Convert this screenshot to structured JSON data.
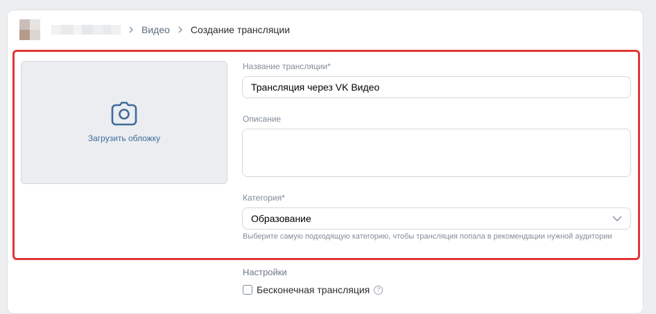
{
  "breadcrumb": {
    "items": [
      {
        "label": "Видео"
      },
      {
        "label": "Создание трансляции"
      }
    ]
  },
  "cover": {
    "icon": "camera-icon",
    "label": "Загрузить обложку"
  },
  "form": {
    "title_label": "Название трансляции*",
    "title_value": "Трансляция через VK Видео",
    "description_label": "Описание",
    "description_value": "",
    "category_label": "Категория*",
    "category_value": "Образование",
    "category_hint": "Выберите самую подходящую категорию, чтобы трансляция попала в рекомендации нужной аудитории"
  },
  "settings": {
    "title": "Настройки",
    "endless_label": "Бесконечная трансляция",
    "endless_checked": false,
    "help_glyph": "?"
  },
  "colors": {
    "accent": "#3f6a9b",
    "highlight": "#e03535",
    "background": "#edeef0"
  }
}
